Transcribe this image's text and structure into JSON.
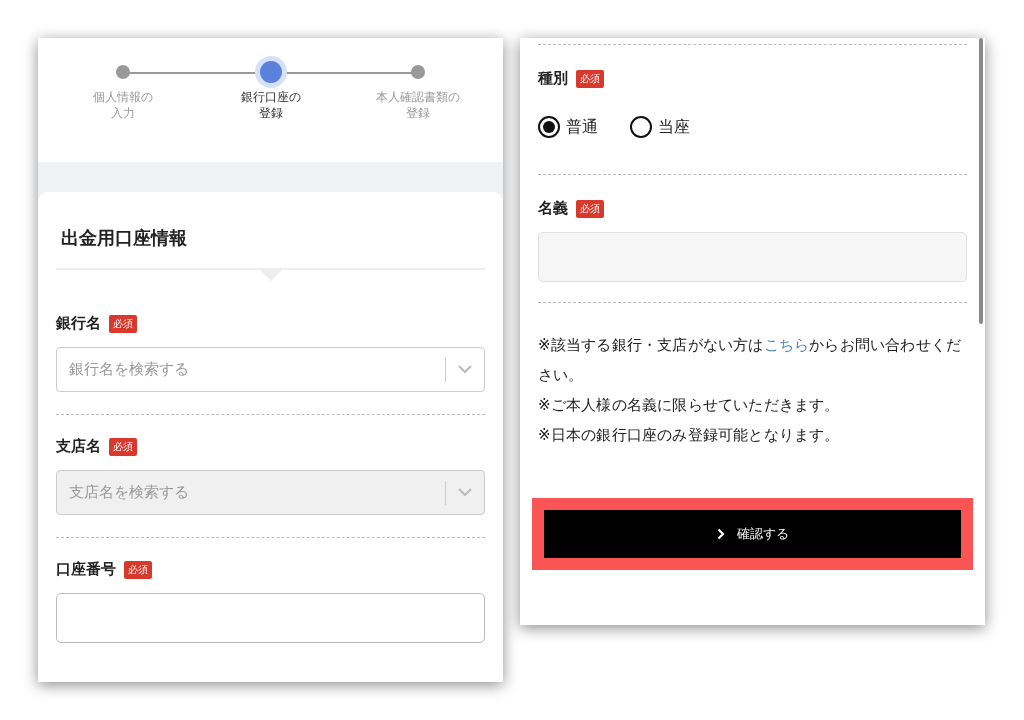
{
  "stepper": {
    "steps": [
      {
        "label_lines": [
          "個人情報の",
          "入力"
        ],
        "selected": false
      },
      {
        "label_lines": [
          "銀行口座の",
          "登録"
        ],
        "selected": true
      },
      {
        "label_lines": [
          "本人確認書類の",
          "登録"
        ],
        "selected": false
      }
    ]
  },
  "left_form": {
    "section_title": "出金用口座情報",
    "fields": [
      {
        "kind": "select",
        "label": "銀行名",
        "badge": "必須",
        "placeholder": "銀行名を検索する",
        "disabled": false
      },
      {
        "kind": "select",
        "label": "支店名",
        "badge": "必須",
        "placeholder": "支店名を検索する",
        "disabled": true
      },
      {
        "kind": "text",
        "label": "口座番号",
        "badge": "必須",
        "disabled": false
      }
    ]
  },
  "right_form": {
    "fields": [
      {
        "kind": "radio",
        "label": "種別",
        "badge": "必須",
        "options": [
          {
            "label": "普通",
            "selected": true
          },
          {
            "label": "当座",
            "selected": false
          }
        ]
      },
      {
        "kind": "text",
        "label": "名義",
        "badge": "必須",
        "disabled": true
      }
    ],
    "notes": [
      {
        "before": "※該当する銀行・支店がない方は",
        "link": "こちら",
        "after": "からお問い合わせください。"
      },
      {
        "before": "※ご本人様の名義に限らせていただきます。"
      },
      {
        "before": "※日本の銀行口座のみ登録可能となります。"
      }
    ],
    "confirm_button": {
      "label": "確認する",
      "highlighted": true
    }
  }
}
